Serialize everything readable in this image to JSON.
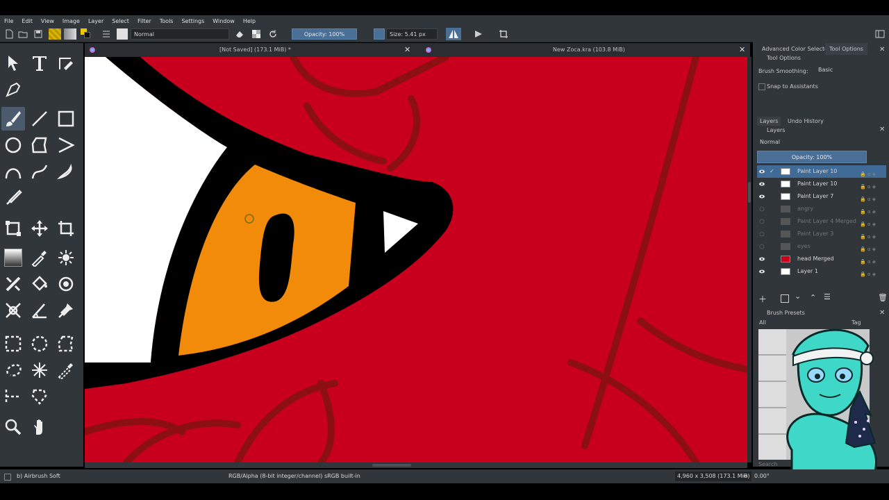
{
  "menu": [
    "File",
    "Edit",
    "View",
    "Image",
    "Layer",
    "Select",
    "Filter",
    "Tools",
    "Settings",
    "Window",
    "Help"
  ],
  "toolbar": {
    "blend_mode": "Normal",
    "opacity": "Opacity: 100%",
    "size": "Size: 5.41 px"
  },
  "tabs": [
    {
      "title": "[Not Saved]  (173.1 MiB) *"
    },
    {
      "title": "New Zoca.kra  (103.8 MiB)"
    }
  ],
  "docker": {
    "top_tabs": [
      "Advanced Color Selector",
      "Tool Options"
    ],
    "tool_options_title": "Tool Options",
    "brush_smoothing_label": "Brush Smoothing:",
    "brush_smoothing_value": "Basic",
    "snap_label": "Snap to Assistants",
    "layer_tabs": [
      "Layers",
      "Undo History"
    ],
    "layers_title": "Layers",
    "layers_blend": "Normal",
    "layers_opacity": "Opacity:  100%",
    "layers": [
      {
        "name": "Paint Layer 10",
        "visible": true,
        "selected": true
      },
      {
        "name": "Paint Layer 10",
        "visible": true,
        "selected": false
      },
      {
        "name": "Paint Layer 7",
        "visible": true,
        "selected": false
      },
      {
        "name": "angry",
        "visible": false,
        "selected": false
      },
      {
        "name": "Paint Layer 4 Merged",
        "visible": false,
        "selected": false
      },
      {
        "name": "Paint Layer 3",
        "visible": false,
        "selected": false
      },
      {
        "name": "eyes",
        "visible": false,
        "selected": false
      },
      {
        "name": "head Merged",
        "visible": true,
        "selected": false
      },
      {
        "name": "Layer 1",
        "visible": true,
        "selected": false
      }
    ],
    "brush_presets_title": "Brush Presets",
    "brush_filter": "All",
    "brush_tag": "Tag",
    "search_placeholder": "Search"
  },
  "status": {
    "brush": "b) Airbrush Soft",
    "color_info": "RGB/Alpha (8-bit integer/channel)  sRGB built-in",
    "dimensions": "4,960 x 3,508 (173.1 MiB)",
    "rotation": "0.00°"
  },
  "colors": {
    "ui_bg": "#31363b",
    "canvas_red": "#c8001e",
    "eye_orange": "#f28a0a",
    "selection_blue": "#3f6b96",
    "character_teal": "#3fd8c8"
  }
}
